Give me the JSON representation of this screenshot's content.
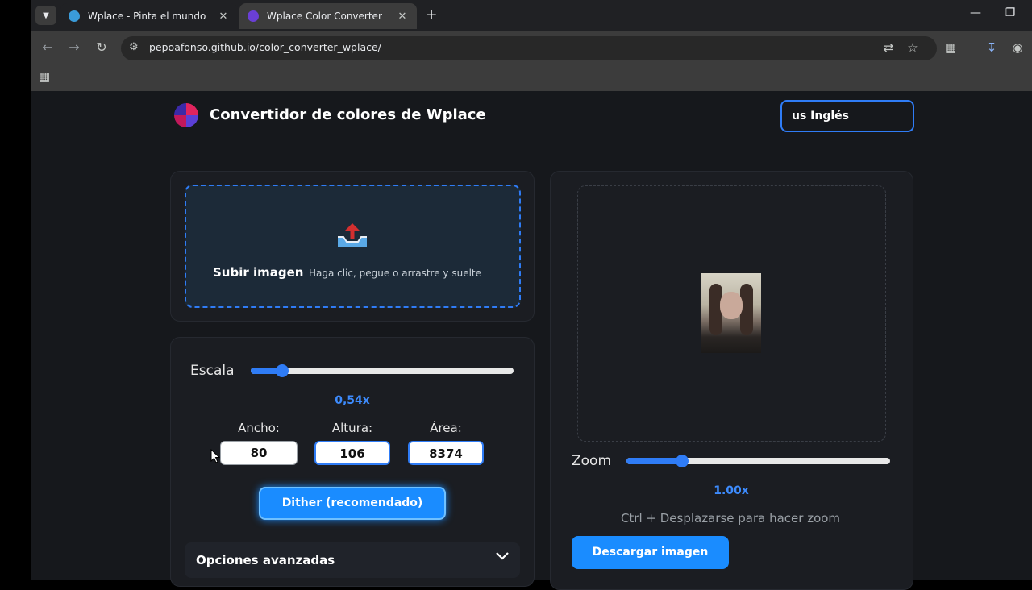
{
  "browser": {
    "tabs": [
      {
        "title": "Wplace - Pinta el mundo"
      },
      {
        "title": "Wplace Color Converter"
      }
    ],
    "url": "pepoafonso.github.io/color_converter_wplace/"
  },
  "header": {
    "title": "Convertidor de colores de Wplace",
    "language": "us Inglés"
  },
  "upload": {
    "title": "Subir imagen",
    "hint": "Haga clic, pegue o arrastre y suelte"
  },
  "controls": {
    "scale_label": "Escala",
    "scale_value": "0,54x",
    "scale_fraction": 0.12,
    "width_label": "Ancho:",
    "width_value": "80",
    "height_label": "Altura:",
    "height_value": "106",
    "area_label": "Área:",
    "area_value": "8374",
    "dither_button": "Dither (recomendado)",
    "advanced_label": "Opciones avanzadas"
  },
  "preview": {
    "zoom_label": "Zoom",
    "zoom_value": "1.00x",
    "zoom_fraction": 0.21,
    "zoom_hint": "Ctrl + Desplazarse para hacer zoom",
    "download_button": "Descargar imagen"
  },
  "colors": {
    "accent": "#2f7cf6",
    "button": "#1a8cff",
    "background": "#16181c"
  }
}
